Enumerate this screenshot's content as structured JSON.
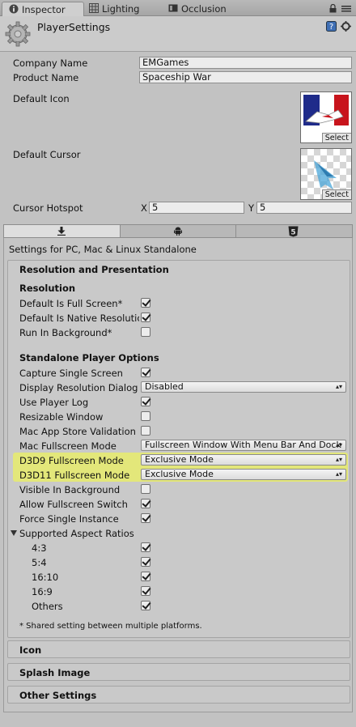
{
  "tabs": [
    {
      "label": "Inspector",
      "icon": "info-icon",
      "active": true
    },
    {
      "label": "Lighting",
      "icon": "lighting-icon",
      "active": false
    },
    {
      "label": "Occlusion",
      "icon": "occlusion-icon",
      "active": false
    }
  ],
  "header": {
    "title": "PlayerSettings"
  },
  "fields": {
    "company_label": "Company Name",
    "company_value": "EMGames",
    "product_label": "Product Name",
    "product_value": "Spaceship War",
    "default_icon_label": "Default Icon",
    "default_cursor_label": "Default Cursor",
    "select_label": "Select",
    "hotspot_label": "Cursor Hotspot",
    "hotspot_x_label": "X",
    "hotspot_x_value": "5",
    "hotspot_y_label": "Y",
    "hotspot_y_value": "5"
  },
  "platform": {
    "settings_for": "Settings for PC, Mac & Linux Standalone",
    "html5_badge": "5"
  },
  "resolution": {
    "section_title": "Resolution and Presentation",
    "resolution_heading": "Resolution",
    "full_screen_label": "Default Is Full Screen*",
    "full_screen_checked": true,
    "native_label": "Default Is Native Resolutio",
    "native_checked": true,
    "background_label": "Run In Background*",
    "background_checked": false,
    "standalone_heading": "Standalone Player Options",
    "capture_label": "Capture Single Screen",
    "capture_checked": true,
    "dialog_label": "Display Resolution Dialog",
    "dialog_value": "Disabled",
    "log_label": "Use Player Log",
    "log_checked": true,
    "resizable_label": "Resizable Window",
    "resizable_checked": false,
    "macstore_label": "Mac App Store Validation",
    "macstore_checked": false,
    "mac_full_label": "Mac Fullscreen Mode",
    "mac_full_value": "Fullscreen Window With Menu Bar And Dock",
    "d3d9_label": "D3D9 Fullscreen Mode",
    "d3d9_value": "Exclusive Mode",
    "d3d11_label": "D3D11 Fullscreen Mode",
    "d3d11_value": "Exclusive Mode",
    "visible_bg_label": "Visible In Background",
    "visible_bg_checked": false,
    "fullscreen_switch_label": "Allow Fullscreen Switch",
    "fullscreen_switch_checked": true,
    "single_instance_label": "Force Single Instance",
    "single_instance_checked": true,
    "aspect_label": "Supported Aspect Ratios",
    "aspects": [
      {
        "label": "4:3",
        "checked": true
      },
      {
        "label": "5:4",
        "checked": true
      },
      {
        "label": "16:10",
        "checked": true
      },
      {
        "label": "16:9",
        "checked": true
      },
      {
        "label": "Others",
        "checked": true
      }
    ],
    "footnote": "* Shared setting between multiple platforms."
  },
  "collapsed_sections": [
    "Icon",
    "Splash Image",
    "Other Settings"
  ],
  "colors": {
    "highlight": "#e3e77a",
    "panel": "#c2c2c2"
  }
}
